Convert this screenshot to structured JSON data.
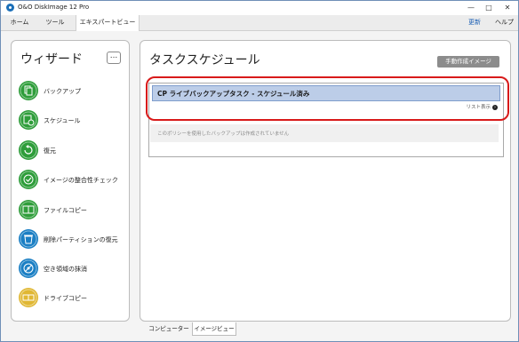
{
  "window": {
    "title": "O&O DiskImage 12 Pro",
    "minimize": "—",
    "maximize": "□",
    "close": "✕"
  },
  "menu": {
    "tabs": [
      "ホーム",
      "ツール",
      "エキスパートビュー"
    ],
    "active_tab": "エキスパートビュー",
    "update": "更新",
    "help": "ヘルプ"
  },
  "wizard": {
    "title": "ウィザード",
    "more": "...",
    "items": [
      {
        "label": "バックアップ",
        "icon": "backup-icon",
        "color": "#2e9d3a"
      },
      {
        "label": "スケジュール",
        "icon": "schedule-icon",
        "color": "#2e9d3a"
      },
      {
        "label": "復元",
        "icon": "restore-icon",
        "color": "#2e9d3a"
      },
      {
        "label": "イメージの整合性チェック",
        "icon": "check-icon",
        "color": "#2e9d3a"
      },
      {
        "label": "ファイルコピー",
        "icon": "file-copy-icon",
        "color": "#2e9d3a"
      },
      {
        "label": "削除パーティションの復元",
        "icon": "recycle-icon",
        "color": "#1b7fc4"
      },
      {
        "label": "空き領域の抹消",
        "icon": "disk-wipe-icon",
        "color": "#1b7fc4"
      },
      {
        "label": "ドライブコピー",
        "icon": "drive-copy-icon",
        "color": "#e0b733"
      }
    ]
  },
  "main": {
    "title": "タスクスケジュール",
    "manual_button": "手動作成イメージ >>>",
    "task_name": "CP ライブバックアップタスク - スケジュール済み",
    "list_view": "リスト表示",
    "no_backup_message": "このポリシーを使用したバックアップは作成されていません"
  },
  "bottom_tabs": [
    "コンピューター",
    "イメージビュー"
  ],
  "colors": {
    "highlight": "#d81a1a",
    "task_header": "#bccde8",
    "green": "#2e9d3a",
    "blue": "#1b7fc4",
    "yellow": "#e0b733"
  }
}
